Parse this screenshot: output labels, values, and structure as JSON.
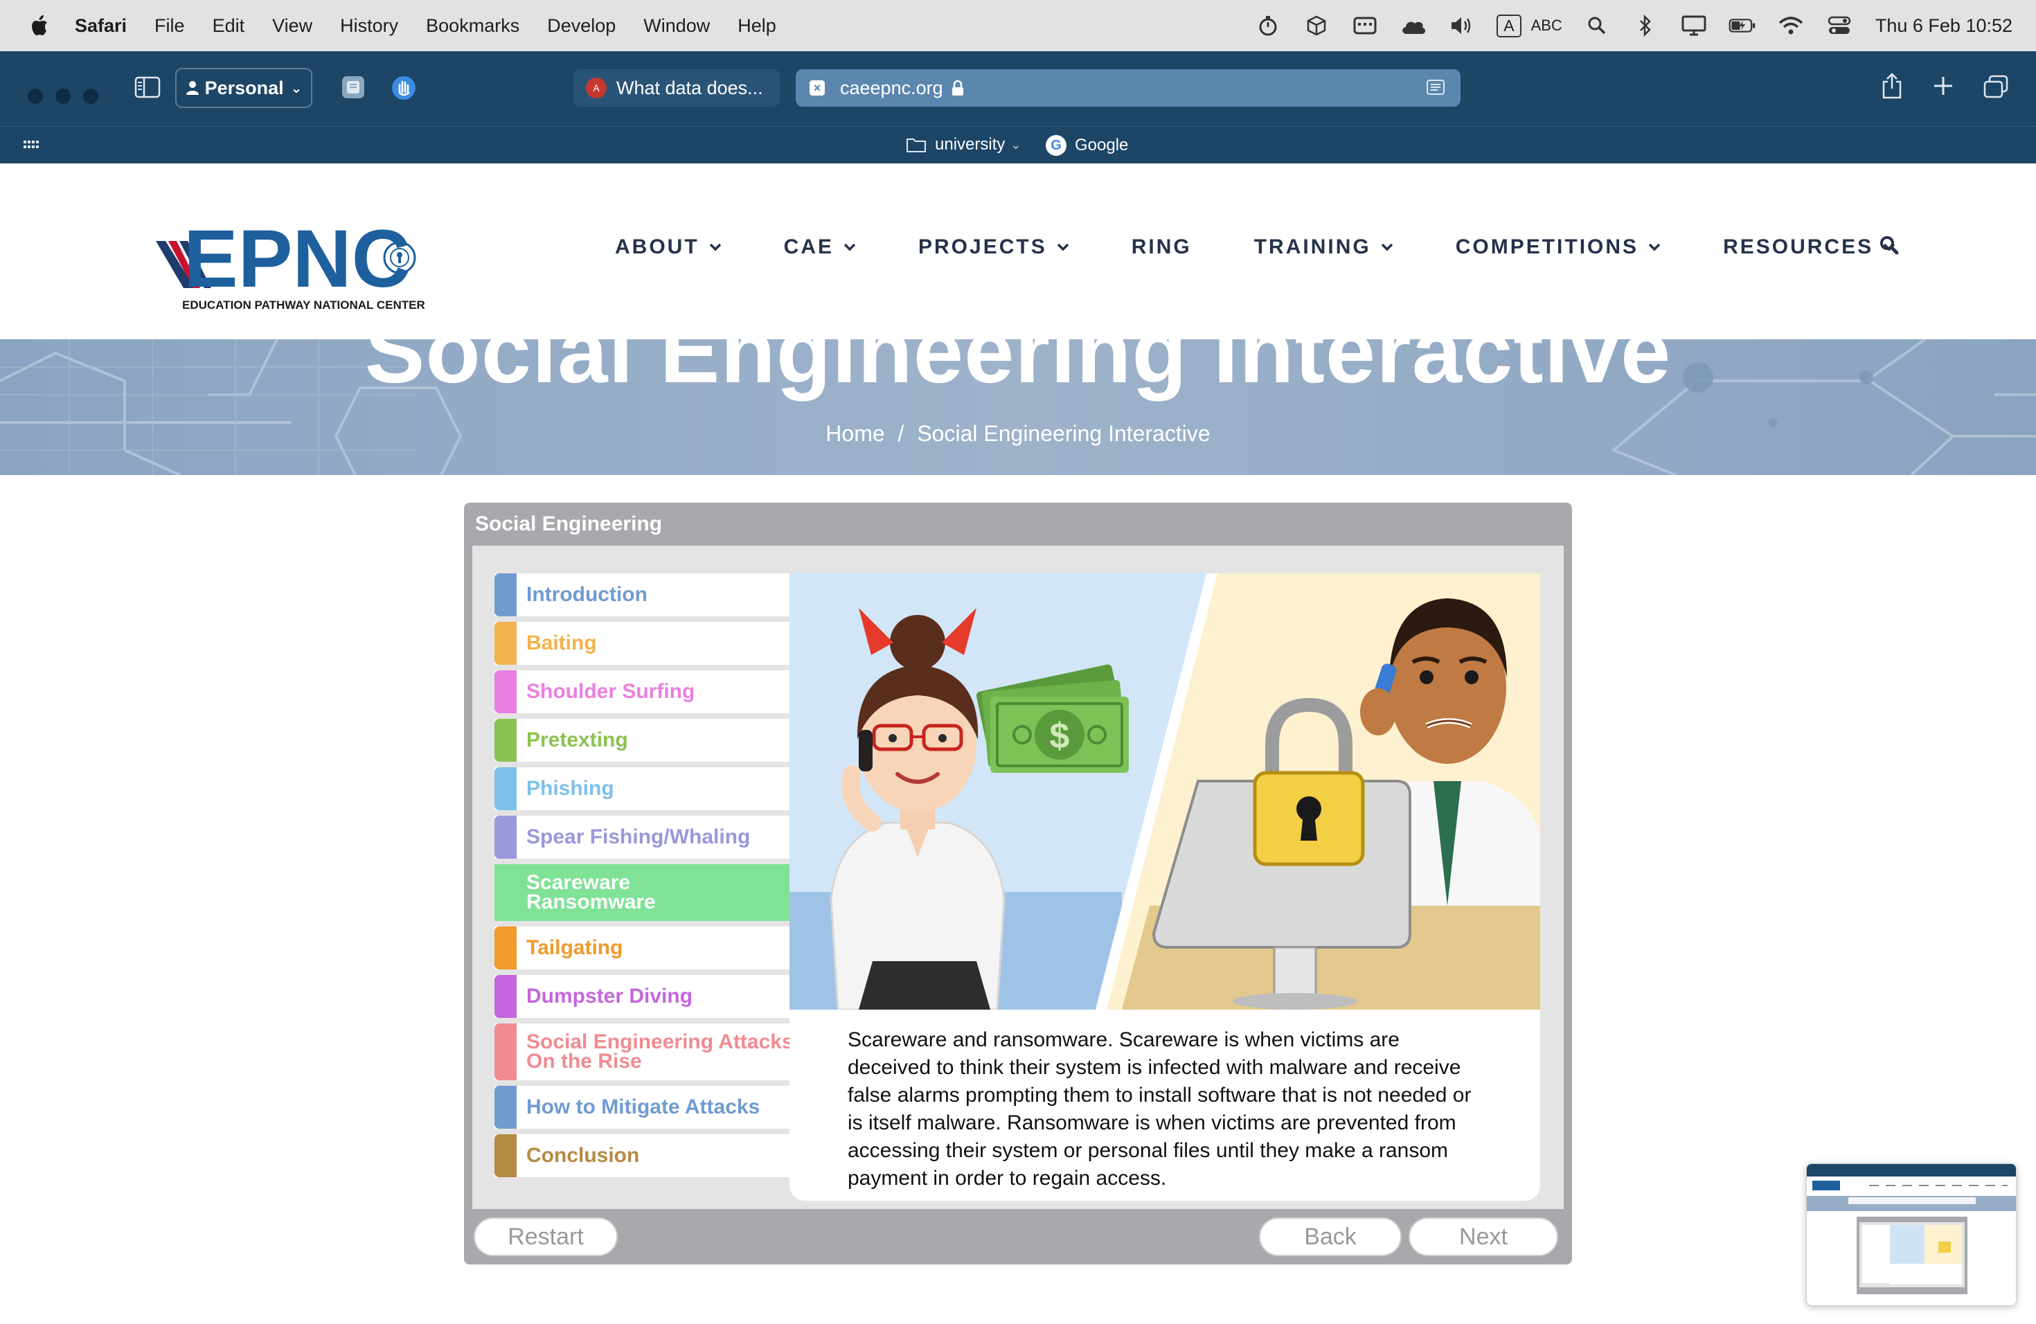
{
  "menubar": {
    "app": "Safari",
    "items": [
      "File",
      "Edit",
      "View",
      "History",
      "Bookmarks",
      "Develop",
      "Window",
      "Help"
    ],
    "input_source": "A",
    "input_label": "ABC",
    "clock": "Thu 6 Feb  10:52"
  },
  "browser": {
    "profile": "Personal",
    "tab_inactive": "What data does...",
    "address": "caeepnc.org",
    "bookmarks": [
      {
        "label": "university",
        "icon": "folder-icon"
      },
      {
        "label": "Google",
        "icon": "google-icon"
      }
    ]
  },
  "site": {
    "logo_text": "EPNC",
    "logo_subtitle": "EDUCATION PATHWAY NATIONAL CENTER",
    "nav": [
      {
        "label": "ABOUT",
        "dropdown": true
      },
      {
        "label": "CAE",
        "dropdown": true
      },
      {
        "label": "PROJECTS",
        "dropdown": true
      },
      {
        "label": "RING",
        "dropdown": false
      },
      {
        "label": "TRAINING",
        "dropdown": true
      },
      {
        "label": "COMPETITIONS",
        "dropdown": true
      },
      {
        "label": "RESOURCES",
        "dropdown": true
      }
    ],
    "hero_title": "Social Engineering Interactive",
    "breadcrumb": {
      "home": "Home",
      "sep": "/",
      "current": "Social Engineering Interactive"
    }
  },
  "module": {
    "title": "Social Engineering",
    "menu": [
      {
        "label": "Introduction",
        "color": "#6f9bd0"
      },
      {
        "label": "Baiting",
        "color": "#f2b24d"
      },
      {
        "label": "Shoulder Surfing",
        "color": "#ea7fe0"
      },
      {
        "label": "Pretexting",
        "color": "#8cc251"
      },
      {
        "label": "Phishing",
        "color": "#7ec0ea"
      },
      {
        "label": "Spear Fishing/Whaling",
        "color": "#9b97dc"
      },
      {
        "label": "Scareware\nRansomware",
        "color": "#80e296",
        "active": true
      },
      {
        "label": "Tailgating",
        "color": "#f19a2e"
      },
      {
        "label": "Dumpster Diving",
        "color": "#c466dd"
      },
      {
        "label": "Social Engineering Attacks\nOn the Rise",
        "color": "#ef8c91"
      },
      {
        "label": "How to Mitigate Attacks",
        "color": "#6f9bd0"
      },
      {
        "label": "Conclusion",
        "color": "#b58a44"
      }
    ],
    "caption": "Scareware and ransomware. Scareware is when victims are deceived to think their system is infected with malware and receive false alarms prompting them to install software that is not needed or is itself malware. Ransomware is when victims are prevented from accessing their system or personal files until they make a ransom payment in order to regain access.",
    "buttons": {
      "restart": "Restart",
      "back": "Back",
      "next": "Next"
    }
  }
}
